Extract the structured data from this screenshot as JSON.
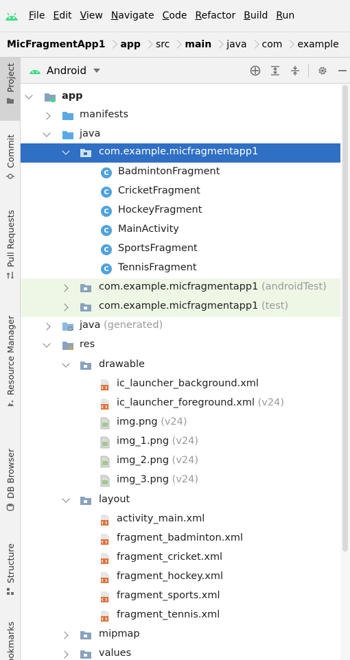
{
  "menu": {
    "items": [
      {
        "mnemonic": "F",
        "rest": "ile"
      },
      {
        "mnemonic": "E",
        "rest": "dit"
      },
      {
        "mnemonic": "V",
        "rest": "iew"
      },
      {
        "mnemonic": "N",
        "rest": "avigate"
      },
      {
        "mnemonic": "C",
        "rest": "ode"
      },
      {
        "mnemonic": "R",
        "rest": "efactor"
      },
      {
        "mnemonic": "B",
        "rest": "uild"
      },
      {
        "mnemonic": "R",
        "rest": "un"
      }
    ]
  },
  "breadcrumb": [
    "MicFragmentApp1",
    "app",
    "src",
    "main",
    "java",
    "com",
    "example"
  ],
  "stripe": {
    "project": "Project",
    "commit": "Commit",
    "pull_requests": "Pull Requests",
    "resource_manager": "Resource Manager",
    "db_browser": "DB Browser",
    "structure": "Structure",
    "bookmarks": "Bookmarks"
  },
  "panel": {
    "view_name": "Android"
  },
  "tree": [
    {
      "label": "app",
      "hint": ""
    },
    {
      "label": "manifests",
      "hint": ""
    },
    {
      "label": "java",
      "hint": ""
    },
    {
      "label": "com.example.micfragmentapp1",
      "hint": ""
    },
    {
      "label": "BadmintonFragment",
      "hint": ""
    },
    {
      "label": "CricketFragment",
      "hint": ""
    },
    {
      "label": "HockeyFragment",
      "hint": ""
    },
    {
      "label": "MainActivity",
      "hint": ""
    },
    {
      "label": "SportsFragment",
      "hint": ""
    },
    {
      "label": "TennisFragment",
      "hint": ""
    },
    {
      "label": "com.example.micfragmentapp1",
      "hint": "(androidTest)"
    },
    {
      "label": "com.example.micfragmentapp1",
      "hint": "(test)"
    },
    {
      "label": "java",
      "hint": "(generated)"
    },
    {
      "label": "res",
      "hint": ""
    },
    {
      "label": "drawable",
      "hint": ""
    },
    {
      "label": "ic_launcher_background.xml",
      "hint": ""
    },
    {
      "label": "ic_launcher_foreground.xml",
      "hint": "(v24)"
    },
    {
      "label": "img.png",
      "hint": "(v24)"
    },
    {
      "label": "img_1.png",
      "hint": "(v24)"
    },
    {
      "label": "img_2.png",
      "hint": "(v24)"
    },
    {
      "label": "img_3.png",
      "hint": "(v24)"
    },
    {
      "label": "layout",
      "hint": ""
    },
    {
      "label": "activity_main.xml",
      "hint": ""
    },
    {
      "label": "fragment_badminton.xml",
      "hint": ""
    },
    {
      "label": "fragment_cricket.xml",
      "hint": ""
    },
    {
      "label": "fragment_hockey.xml",
      "hint": ""
    },
    {
      "label": "fragment_sports.xml",
      "hint": ""
    },
    {
      "label": "fragment_tennis.xml",
      "hint": ""
    },
    {
      "label": "mipmap",
      "hint": ""
    },
    {
      "label": "values",
      "hint": ""
    }
  ],
  "class_icon_letter": "C",
  "colors": {
    "selection": "#2f6fc4",
    "test_row": "#eef6e6",
    "android_green": "#3ddc84",
    "class_icon": "#4fa2dc",
    "folder_blue": "#5aa9e6",
    "xml_orange": "#e0703a"
  }
}
